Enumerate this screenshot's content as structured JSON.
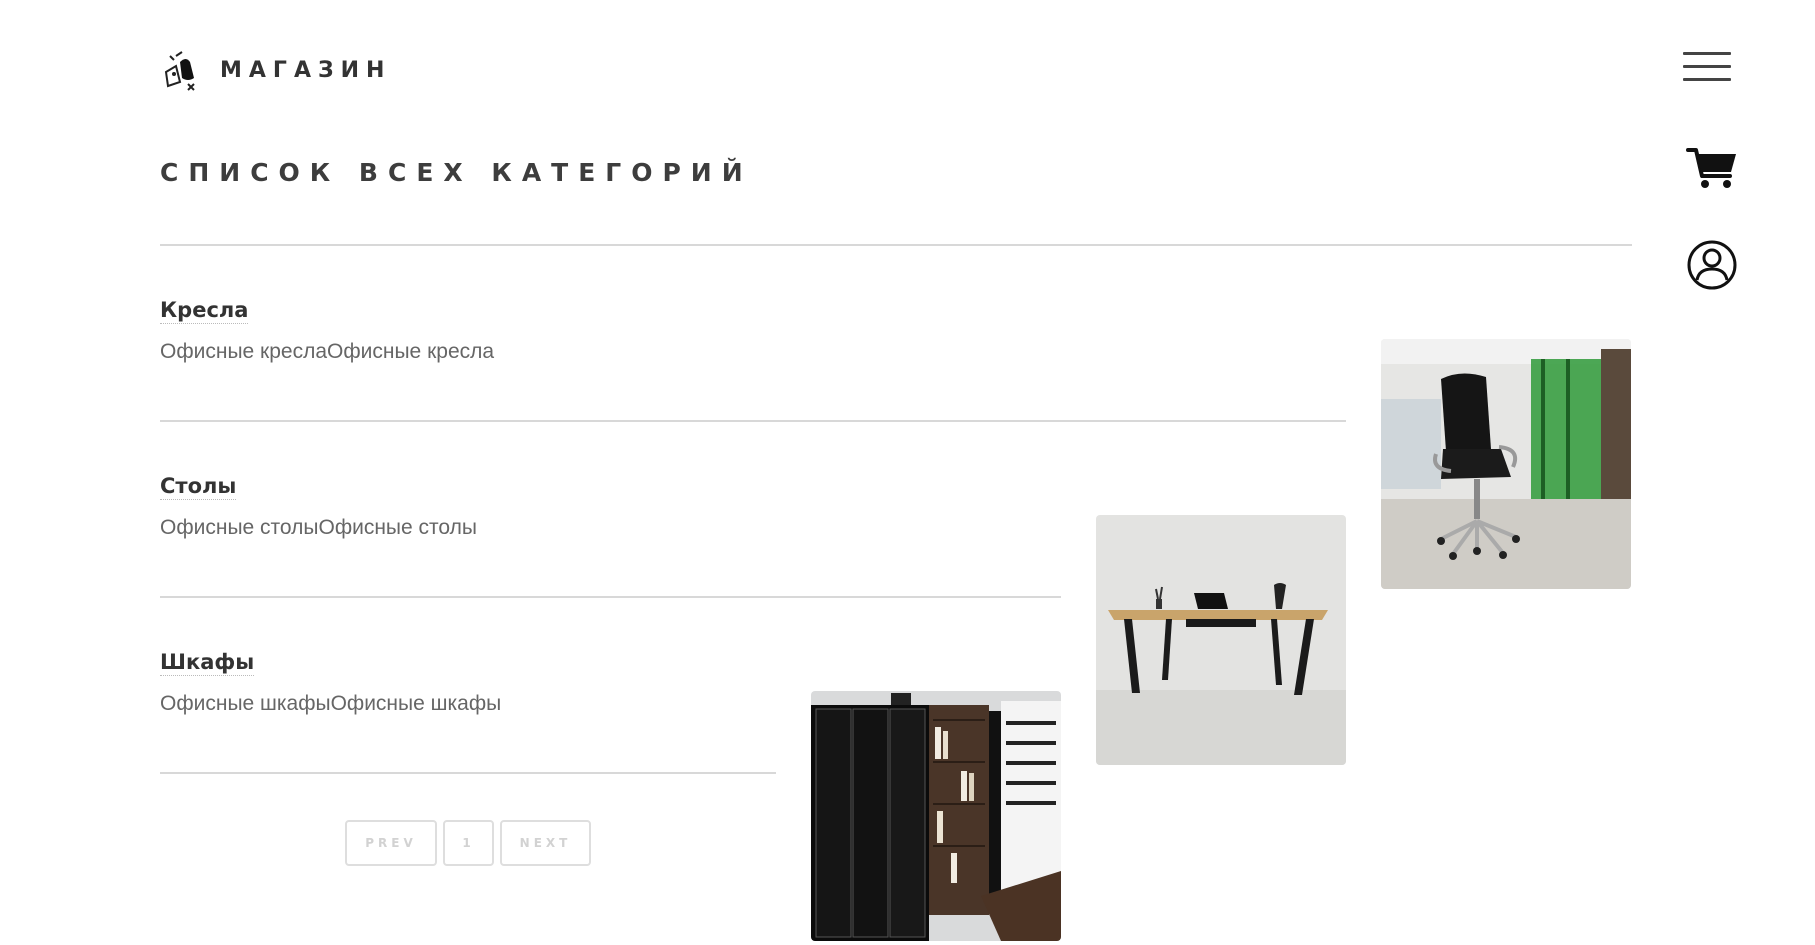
{
  "header": {
    "logo_text": "МАГАЗИН",
    "page_title": "СПИСОК ВСЕХ КАТЕГОРИЙ"
  },
  "icons": {
    "menu": "hamburger-menu-icon",
    "cart": "shopping-cart-icon",
    "user": "user-account-icon"
  },
  "categories": [
    {
      "name": "Кресла",
      "description": "Офисные креслаОфисные кресла",
      "image": "office-chair-image"
    },
    {
      "name": "Столы",
      "description": "Офисные столыОфисные столы",
      "image": "office-desk-image"
    },
    {
      "name": "Шкафы",
      "description": "Офисные шкафыОфисные шкафы",
      "image": "office-cabinet-image"
    }
  ],
  "pagination": {
    "prev": "PREV",
    "current": "1",
    "next": "NEXT"
  },
  "colors": {
    "text": "#444444",
    "divider": "#d8d8d8",
    "pager_border": "#dedede",
    "pager_text": "#d2d2d2",
    "chair_wall_accent": "#2f9a3a"
  }
}
